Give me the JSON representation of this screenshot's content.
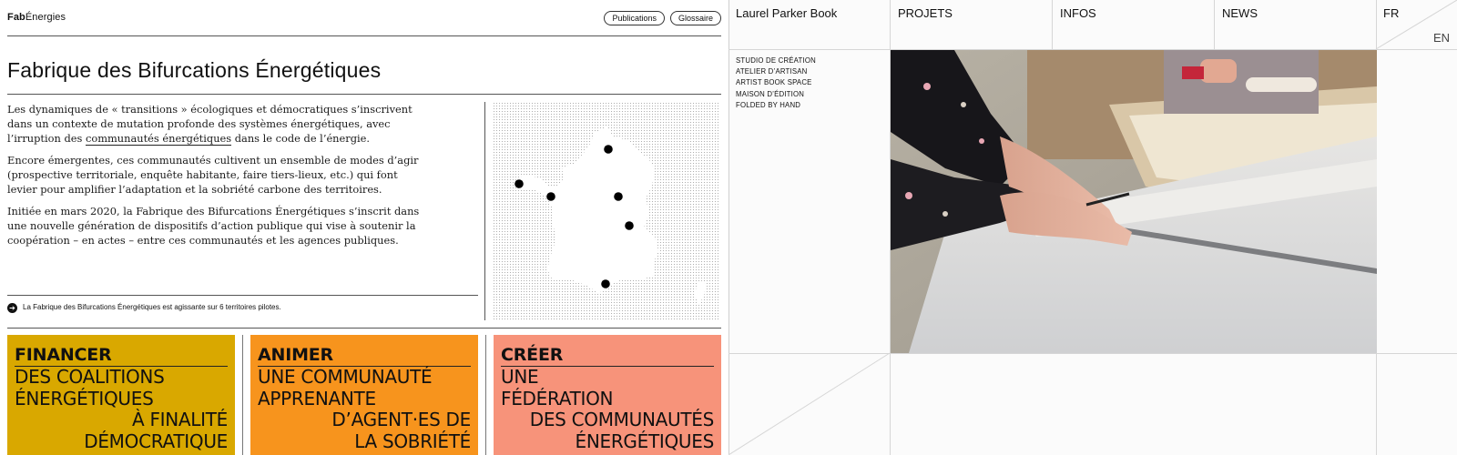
{
  "left": {
    "brand_bold": "Fab",
    "brand_rest": "Énergies",
    "nav": {
      "publications": "Publications",
      "glossaire": "Glossaire"
    },
    "title": "Fabrique des Bifurcations Énergétiques",
    "paragraphs": {
      "p1_pre": "Les dynamiques de « transitions » écologiques et démocratiques s’inscrivent dans un contexte de mutation profonde des systèmes énergétiques, avec l’irruption des ",
      "p1_link": "communautés énergétiques",
      "p1_post": " dans le code de l’énergie.",
      "p2": "Encore émergentes, ces communautés cultivent un ensemble de modes d’agir (prospective territoriale, enquête habitante, faire tiers-lieux, etc.) qui font levier pour amplifier l’adaptation et la sobriété carbone des territoires.",
      "p3": "Initiée en mars 2020, la Fabrique des Bifurcations Énergétiques s’inscrit dans une nouvelle génération de dispositifs d’action publique qui vise à soutenir la coopération – en actes – entre ces communautés et les agences publiques."
    },
    "note": "La Fabrique des Bifurcations Énergétiques est agissante sur 6 territoires pilotes.",
    "note_icon": "arrow-right-circle-icon",
    "map_pilot_count": 6,
    "cards": [
      {
        "label": "FINANCER",
        "lines": [
          "DES COALITIONS",
          "ÉNERGÉTIQUES"
        ],
        "lines_right": [
          "À FINALITÉ",
          "DÉMOCRATIQUE"
        ],
        "color": "#D9A800"
      },
      {
        "label": "ANIMER",
        "lines": [
          "UNE COMMUNAUTÉ",
          "APPRENANTE"
        ],
        "lines_right": [
          "D’AGENT·ES DE",
          "LA SOBRIÉTÉ"
        ],
        "color": "#F7941D"
      },
      {
        "label": "CRÉER",
        "lines": [
          "UNE",
          "FÉDÉRATION"
        ],
        "lines_right": [
          "DES COMMUNAUTÉS",
          "ÉNERGÉTIQUES"
        ],
        "color": "#F7937A"
      }
    ]
  },
  "right": {
    "site_title": "Laurel Parker Book",
    "nav": {
      "projets": "PROJETS",
      "infos": "INFOS",
      "news": "NEWS",
      "fr": "FR",
      "en": "EN"
    },
    "side_items": [
      "STUDIO DE CRÉATION",
      "ATELIER D’ARTISAN",
      "ARTIST BOOK SPACE",
      "MAISON D’ÉDITION",
      "FOLDED BY HAND"
    ]
  }
}
